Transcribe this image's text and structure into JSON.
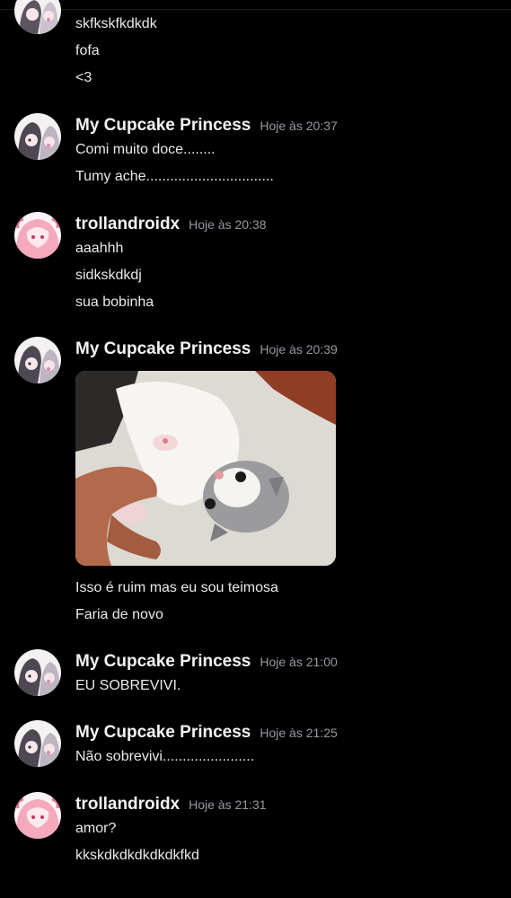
{
  "colors": {
    "background": "#000000",
    "author_name": "#f2f3f5",
    "message_text": "#e9eaec",
    "timestamp": "#949ba4"
  },
  "messages": [
    {
      "author": "",
      "timestamp": "",
      "avatar": "cupcake-princess-avatar",
      "lines": [
        "skfkskfkdkdk",
        "fofa",
        "<3"
      ]
    },
    {
      "author": "My Cupcake Princess",
      "timestamp": "Hoje às 20:37",
      "avatar": "cupcake-princess-avatar",
      "lines": [
        "Comi muito doce........",
        "Tumy ache................................"
      ]
    },
    {
      "author": "trollandroidx",
      "timestamp": "Hoje às 20:38",
      "avatar": "trollandroidx-avatar",
      "lines": [
        "aaahhh",
        "sidkskdkdj",
        "sua bobinha"
      ]
    },
    {
      "author": "My Cupcake Princess",
      "timestamp": "Hoje às 20:39",
      "avatar": "cupcake-princess-avatar",
      "attachment": "kitten-gif",
      "lines": [
        "Isso é ruim mas eu sou teimosa",
        "Faria de novo"
      ]
    },
    {
      "author": "My Cupcake Princess",
      "timestamp": "Hoje às 21:00",
      "avatar": "cupcake-princess-avatar",
      "lines": [
        "EU SOBREVIVI."
      ]
    },
    {
      "author": "My Cupcake Princess",
      "timestamp": "Hoje às 21:25",
      "avatar": "cupcake-princess-avatar",
      "lines": [
        "Não sobrevivi......................."
      ]
    },
    {
      "author": "trollandroidx",
      "timestamp": "Hoje às 21:31",
      "avatar": "trollandroidx-avatar",
      "lines": [
        "amor?",
        "kkskdkdkdkdkdkfkd"
      ]
    }
  ]
}
